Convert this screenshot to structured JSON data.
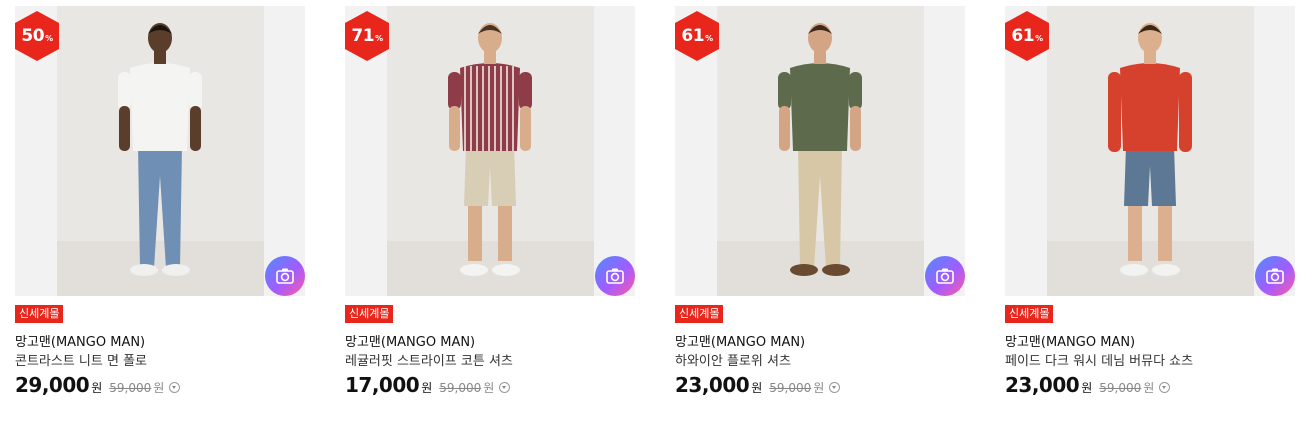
{
  "colors": {
    "discount": "#e8261b",
    "badge": "#e8261b",
    "camera_gradient": [
      "#4f8bff",
      "#a25cff",
      "#ff5aa6"
    ]
  },
  "products": [
    {
      "discount": "50",
      "discount_unit": "%",
      "badge": "신세계몰",
      "brand": "망고맨(MANGO MAN)",
      "name": "콘트라스트 니트 면 폴로",
      "price": "29,000",
      "currency": "원",
      "original_price": "59,000",
      "original_currency": "원",
      "image": {
        "shirt": "#f4f4f2",
        "pants": "#6f8fb5",
        "shoes": "#f0f0ee",
        "skin": "#5a3d2b",
        "hair": "#1a1310"
      }
    },
    {
      "discount": "71",
      "discount_unit": "%",
      "badge": "신세계몰",
      "brand": "망고맨(MANGO MAN)",
      "name": "레귤러핏 스트라이프 코튼 셔츠",
      "price": "17,000",
      "currency": "원",
      "original_price": "59,000",
      "original_currency": "원",
      "image": {
        "shirt": "#8e3c47",
        "pants": "#d8cdb5",
        "shoes": "#f3f3f1",
        "skin": "#d8ad8c",
        "hair": "#4a3324"
      }
    },
    {
      "discount": "61",
      "discount_unit": "%",
      "badge": "신세계몰",
      "brand": "망고맨(MANGO MAN)",
      "name": "하와이안 플로위 셔츠",
      "price": "23,000",
      "currency": "원",
      "original_price": "59,000",
      "original_currency": "원",
      "image": {
        "shirt": "#5e6a4c",
        "pants": "#d7c7a7",
        "shoes": "#6b4a32",
        "skin": "#d3a585",
        "hair": "#3d2a1d"
      }
    },
    {
      "discount": "61",
      "discount_unit": "%",
      "badge": "신세계몰",
      "brand": "망고맨(MANGO MAN)",
      "name": "페이드 다크 워시 데님 버뮤다 쇼츠",
      "price": "23,000",
      "currency": "원",
      "original_price": "59,000",
      "original_currency": "원",
      "image": {
        "shirt": "#d6412e",
        "pants": "#5c7894",
        "shoes": "#f2f2f0",
        "skin": "#dcb08f",
        "hair": "#3a2718"
      }
    }
  ]
}
